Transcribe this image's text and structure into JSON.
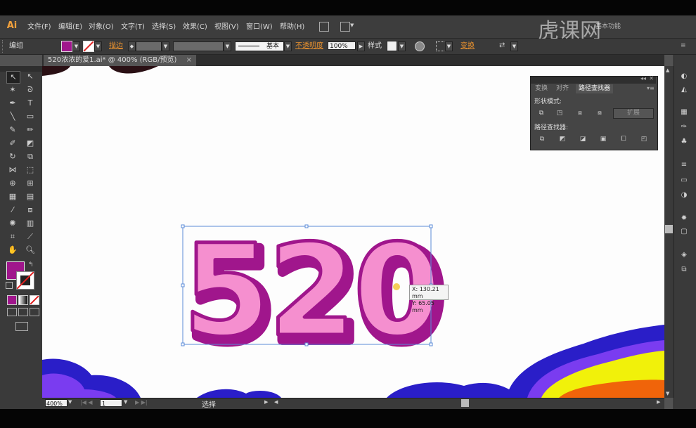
{
  "app": {
    "logo": "Ai"
  },
  "menu": [
    "文件(F)",
    "编辑(E)",
    "对象(O)",
    "文字(T)",
    "选择(S)",
    "效果(C)",
    "视图(V)",
    "窗口(W)",
    "帮助(H)"
  ],
  "workspace_label": "基本功能",
  "watermark": "虎课网",
  "control_bar": {
    "selection_label": "编组",
    "stroke_label": "描边",
    "stroke_style": "基本",
    "opacity_label": "不透明度",
    "opacity_value": "100%",
    "style_label": "样式",
    "transform_label": "变换",
    "fill_color": "#a0168c"
  },
  "document_tab": {
    "title": "520浓浓的爱1.ai* @ 400% (RGB/预览)",
    "close": "×"
  },
  "artwork": {
    "text": "520",
    "fill_light": "#f58fcf",
    "fill_dark": "#a0168c",
    "cursor_readout": {
      "x": "X: 130.21 mm",
      "y": "Y: 65.05 mm"
    }
  },
  "pathfinder_panel": {
    "tabs": [
      "变换",
      "对齐",
      "路径查找器"
    ],
    "active_tab": "路径查找器",
    "shape_modes_label": "形状模式:",
    "expand_button": "扩展",
    "pathfinders_label": "路径查找器:"
  },
  "status_bar": {
    "zoom": "400%",
    "artboard": "1",
    "status_text": "选择"
  },
  "colors": {
    "accent_orange": "#e8912f",
    "wave_blue": "#2a1ec8",
    "wave_purple": "#7a3cf0",
    "wave_yellow": "#f1f10a",
    "wave_orange": "#f0640a"
  }
}
